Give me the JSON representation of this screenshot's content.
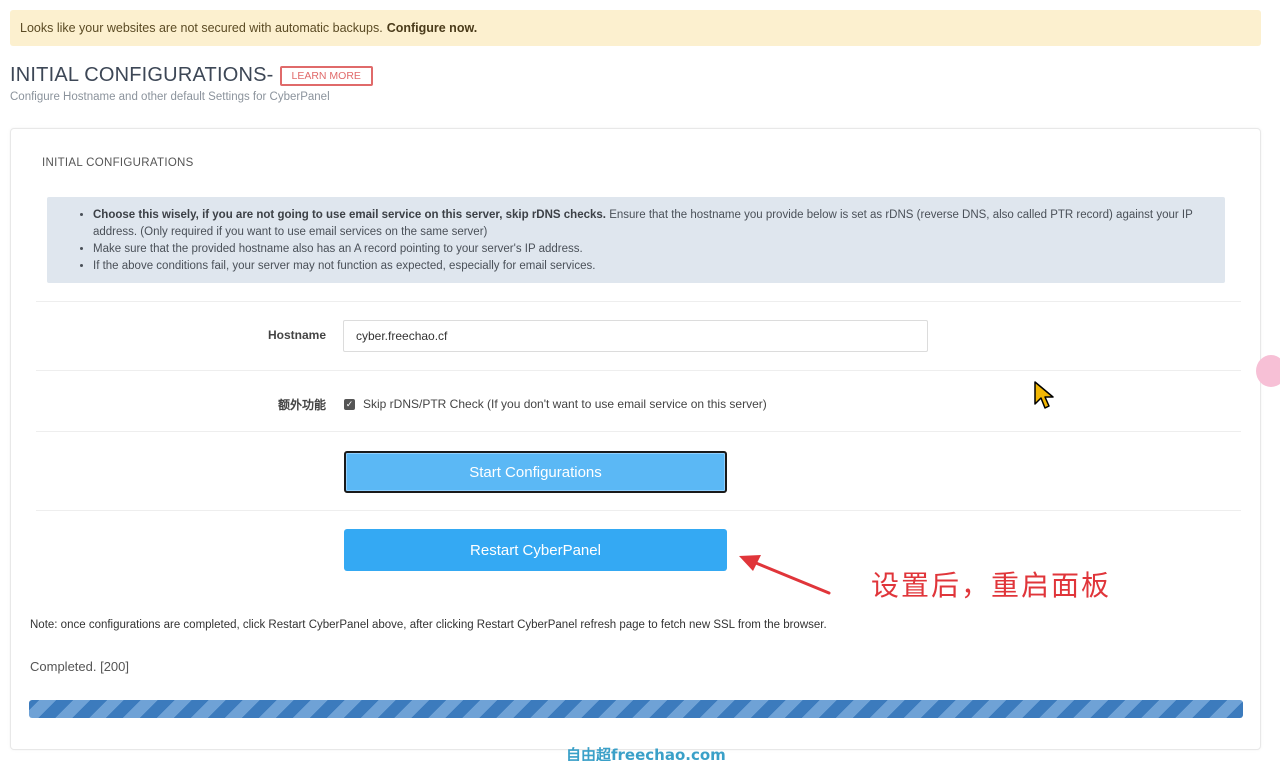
{
  "alert": {
    "message": "Looks like your websites are not secured with automatic backups.",
    "link_label": "Configure now."
  },
  "header": {
    "title": "INITIAL CONFIGURATIONS-",
    "learn_more_label": "LEARN MORE",
    "subtitle": "Configure Hostname and other default Settings for CyberPanel"
  },
  "panel": {
    "title": "INITIAL CONFIGURATIONS",
    "info": {
      "item1_bold": "Choose this wisely, if you are not going to use email service on this server, skip rDNS checks.",
      "item1_rest": " Ensure that the hostname you provide below is set as rDNS (reverse DNS, also called PTR record) against your IP address. (Only required if you want to use email services on the same server)",
      "item2": "Make sure that the provided hostname also has an A record pointing to your server's IP address.",
      "item3": "If the above conditions fail, your server may not function as expected, especially for email services."
    },
    "hostname_label": "Hostname",
    "hostname_value": "cyber.freechao.cf",
    "extra_label": "额外功能",
    "skip_check_label": "Skip rDNS/PTR Check (If you don't want to use email service on this server)",
    "skip_check_checked": true,
    "start_button_label": "Start Configurations",
    "restart_button_label": "Restart CyberPanel",
    "note": "Note: once configurations are completed, click Restart CyberPanel above, after clicking Restart CyberPanel refresh page to fetch new SSL from the browser.",
    "status": "Completed. [200]",
    "progress_percent": 100
  },
  "annotation": {
    "text": "设置后，重启面板",
    "color": "#e0353a"
  },
  "watermark": {
    "text": "自由超freechao.com"
  },
  "colors": {
    "accent": "#34a9f3",
    "alert_bg": "#fcf0cf",
    "danger": "#e06a6a",
    "progress": "#3c7bbd"
  }
}
